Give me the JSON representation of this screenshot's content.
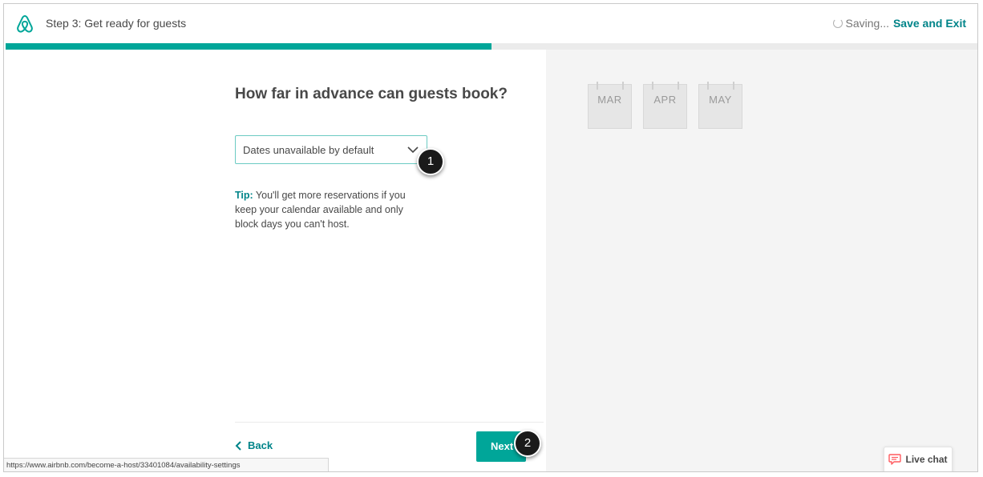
{
  "header": {
    "step_title": "Step 3: Get ready for guests",
    "saving_text": "Saving...",
    "separator": "·",
    "save_exit_label": "Save and Exit"
  },
  "progress": {
    "fraction": 0.5
  },
  "main": {
    "heading": "How far in advance can guests book?",
    "select": {
      "selected_value": "Dates unavailable by default"
    },
    "tip": {
      "label": "Tip:",
      "text": " You'll get more reservations if you keep your calendar available and only block days you can't host."
    },
    "back_label": "Back",
    "next_label": "Next"
  },
  "calendar": {
    "months": [
      "MAR",
      "APR",
      "MAY"
    ]
  },
  "annotations": {
    "badge_1": "1",
    "badge_2": "2"
  },
  "status_bar": {
    "url": "https://www.airbnb.com/become-a-host/33401084/availability-settings"
  },
  "live_chat": {
    "label": "Live chat"
  },
  "colors": {
    "brand_teal": "#00a699",
    "link_teal": "#008489",
    "select_border": "#6ccbc3",
    "chat_icon": "#ff5a5f"
  },
  "icons": {
    "logo": "airbnb-logo-icon",
    "spinner": "spinner-icon",
    "select_chevron": "chevron-down-icon",
    "back_chevron": "chevron-left-icon",
    "chat": "chat-bubble-icon"
  }
}
